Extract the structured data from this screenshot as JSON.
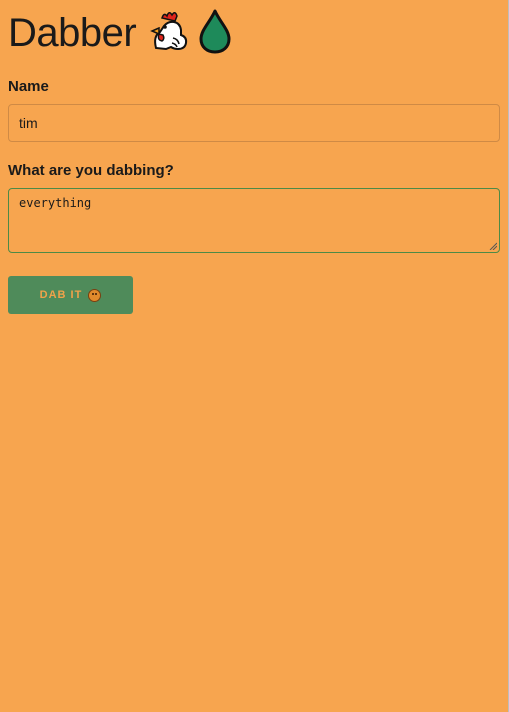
{
  "header": {
    "title": "Dabber",
    "icons": [
      "chicken-icon",
      "droplet-icon"
    ]
  },
  "form": {
    "name_label": "Name",
    "name_value": "tim",
    "dab_label": "What are you dabbing?",
    "dab_value": "everything",
    "submit_label": "DAB IT",
    "submit_icon": "face-emoji-icon"
  },
  "colors": {
    "background": "#f7a54f",
    "button": "#4f8b5a",
    "button_text": "#f0a24a",
    "droplet": "#1e8a5a"
  }
}
